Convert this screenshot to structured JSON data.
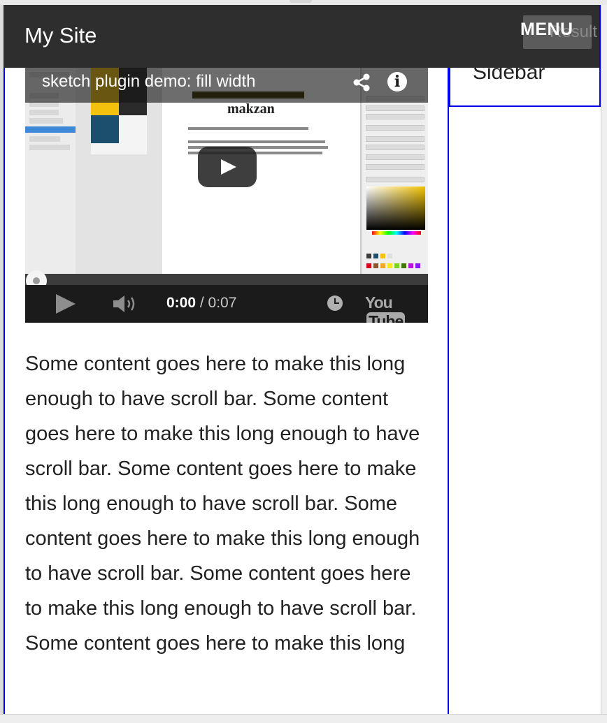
{
  "header": {
    "site_title": "My Site",
    "menu_label": "MENU",
    "result_label": "Result"
  },
  "sidebar": {
    "label": "Sidebar"
  },
  "video": {
    "title": "sketch plugin demo: fill width",
    "thumbnail_heading": "makzan",
    "current_time": "0:00",
    "separator": " / ",
    "duration": "0:07",
    "progress": 0,
    "logo_you": "You",
    "logo_tube": "Tube"
  },
  "main": {
    "content": "Some content goes here to make this long enough to have scroll bar. Some content goes here to make this long enough to have scroll bar. Some content goes here to make this long enough to have scroll bar. Some content goes here to make this long enough to have scroll bar. Some content goes here to make this long enough to have scroll bar. Some content goes here to make this long"
  },
  "colors": {
    "header_bg": "#2e2e2e",
    "outline": "#0000ee",
    "text": "#222222"
  }
}
